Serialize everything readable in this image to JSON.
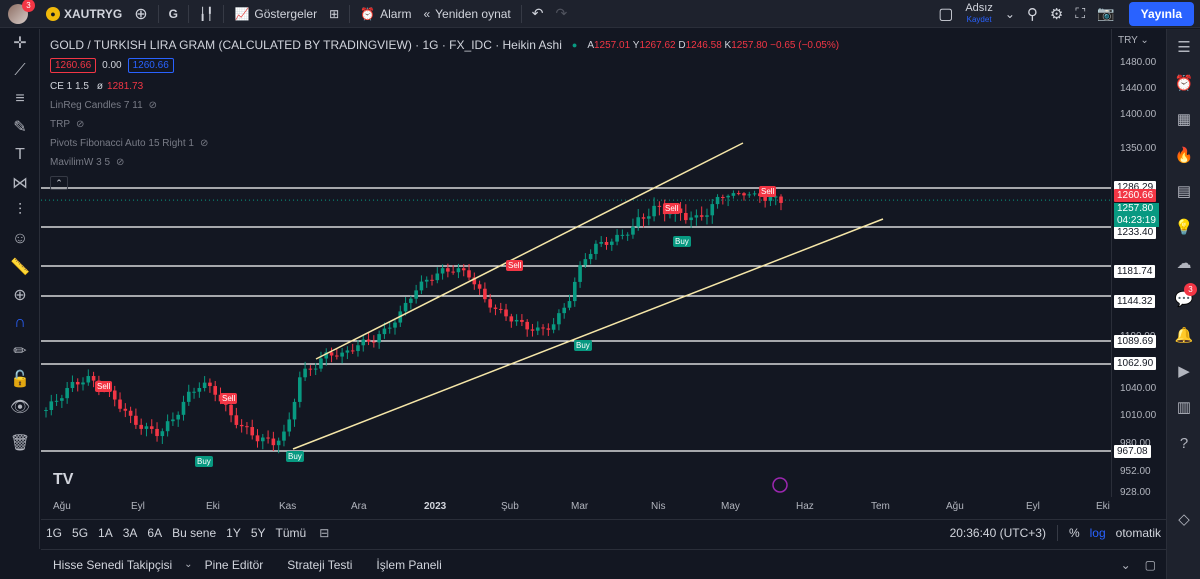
{
  "topbar": {
    "avatar_badge": "3",
    "symbol": "XAUTRYG",
    "interval": "G",
    "indicators_label": "Göstergeler",
    "alert_label": "Alarm",
    "replay_label": "Yeniden oynat",
    "layout_name": "Adsız",
    "layout_sub": "Kaydet",
    "publish_label": "Yayınla"
  },
  "legend": {
    "title": "GOLD / TURKISH LIRA GRAM (CALCULATED BY TRADINGVIEW) · 1G · FX_IDC · Heikin Ashi",
    "a_label": "A",
    "a": "1257.01",
    "y_label": "Y",
    "y": "1267.62",
    "d_label": "D",
    "d": "1246.58",
    "k_label": "K",
    "k": "1257.80",
    "change": "−0.65 (−0.05%)",
    "bid": "1260.66",
    "spread": "0.00",
    "ask": "1260.66",
    "ce_label": "CE 1 1.5",
    "ce_sym": "ø",
    "ce_value": "1281.73",
    "ind1": "LinReg Candles 7 11",
    "ind2": "TRP",
    "ind3": "Pivots Fibonacci Auto 15 Right 1",
    "ind4": "MavilimW 3 5"
  },
  "price_axis": {
    "currency": "TRY",
    "ticks": [
      "1480.00",
      "1440.00",
      "1400.00",
      "1350.00",
      "1300.00",
      "1100.00",
      "1070.00",
      "1040.00",
      "1010.00",
      "980.00",
      "952.00",
      "928.00"
    ],
    "levels": [
      "1286.29",
      "1233.40",
      "1181.74",
      "1144.32",
      "1089.69",
      "1062.90",
      "967.08"
    ],
    "last_price": "1260.66",
    "current": "1257.80",
    "countdown": "04:23:19"
  },
  "time_axis": [
    "Ağu",
    "Eyl",
    "Eki",
    "Kas",
    "Ara",
    "2023",
    "Şub",
    "Mar",
    "Nis",
    "May",
    "Haz",
    "Tem",
    "Ağu",
    "Eyl",
    "Eki"
  ],
  "signals": [
    {
      "label": "Sell"
    },
    {
      "label": "Sell"
    },
    {
      "label": "Buy"
    },
    {
      "label": "Buy"
    },
    {
      "label": "Sell"
    },
    {
      "label": "Buy"
    },
    {
      "label": "Sell"
    },
    {
      "label": "Buy"
    },
    {
      "label": "Sell"
    }
  ],
  "range_bar": {
    "ranges": [
      "1G",
      "5G",
      "1A",
      "3A",
      "6A",
      "Bu sene",
      "1Y",
      "5Y",
      "Tümü"
    ],
    "clock": "20:36:40 (UTC+3)",
    "percent": "%",
    "log": "log",
    "auto": "otomatik"
  },
  "bottom_tabs": [
    "Hisse Senedi Takipçisi",
    "Pine Editör",
    "Strateji Testi",
    "İşlem Paneli"
  ],
  "right_badge": "3",
  "colors": {
    "up": "#089981",
    "down": "#f23645",
    "accent": "#2962ff",
    "trend": "#f5e6a8"
  },
  "chart_data": {
    "type": "candlestick",
    "style": "Heikin Ashi",
    "levels": [
      1286.29,
      1233.4,
      1181.74,
      1144.32,
      1089.69,
      1062.9,
      967.08
    ],
    "approx_closes": [
      1010,
      1025,
      1040,
      1045,
      1035,
      1020,
      1000,
      990,
      985,
      1000,
      1025,
      1040,
      1030,
      1005,
      990,
      980,
      975,
      985,
      1050,
      1060,
      1075,
      1072,
      1085,
      1090,
      1100,
      1120,
      1150,
      1165,
      1175,
      1178,
      1170,
      1140,
      1125,
      1115,
      1105,
      1100,
      1110,
      1140,
      1190,
      1210,
      1215,
      1225,
      1240,
      1250,
      1248,
      1245,
      1240,
      1250,
      1265,
      1270,
      1268,
      1260,
      1257.8
    ]
  }
}
